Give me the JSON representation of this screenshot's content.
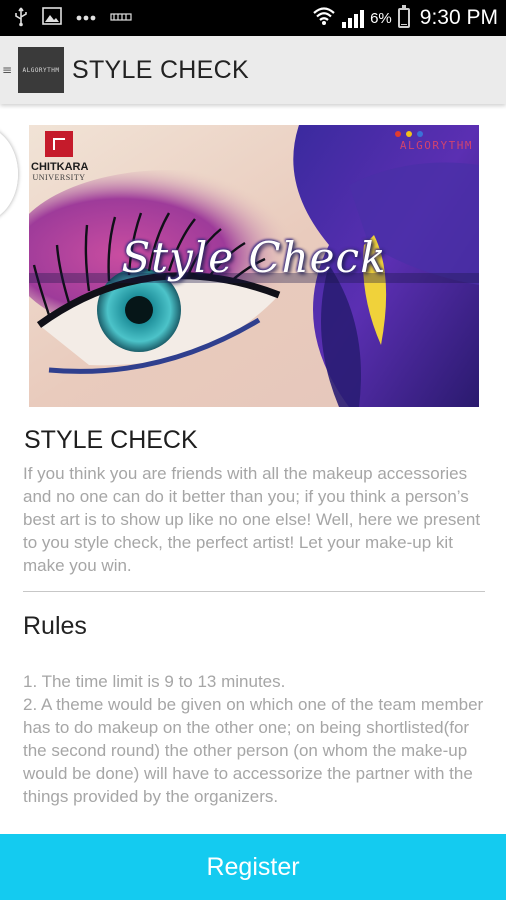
{
  "status_bar": {
    "icons": [
      "usb-icon",
      "image-icon",
      "more-dots-icon",
      "voicemail-icon",
      "wifi-icon",
      "signal-icon",
      "battery-icon"
    ],
    "battery_percent": "6%",
    "battery_level": 0.06,
    "time": "9:30 PM"
  },
  "action_bar": {
    "logo_text": "ALGORYTHM",
    "title": "STYLE CHECK"
  },
  "banner": {
    "brand_left_name": "CHITKARA",
    "brand_left_sub": "UNIVERSITY",
    "brand_right_name": "ALGORYTHM",
    "brand_dot_colors": [
      "#e23b2e",
      "#f2c21a",
      "#3a72d8"
    ],
    "title": "Style Check"
  },
  "event": {
    "title": "STYLE CHECK",
    "description": "If you think you are friends with all the makeup accessories and no one can do it better than you; if you think a person’s best art is to show up like no one else! Well, here we present to you style check, the perfect artist! Let your make-up kit make you win."
  },
  "rules": {
    "heading": "Rules",
    "items": [
      "1. The time limit is 9 to 13 minutes.",
      "2. A theme would be given on which one of the team member has to do makeup on the other one; on being shortlisted(for the second round) the other person (on whom the make-up would be done) will have to accessorize the partner with the things provided by the organizers."
    ]
  },
  "register": {
    "label": "Register",
    "color": "#14cbf0"
  }
}
